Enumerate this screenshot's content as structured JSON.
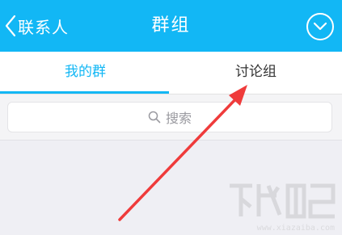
{
  "header": {
    "back_label": "联系人",
    "title": "群组",
    "menu_icon": "chevron-down-circle-icon"
  },
  "tabs": [
    {
      "label": "我的群",
      "active": true
    },
    {
      "label": "讨论组",
      "active": false
    }
  ],
  "search": {
    "placeholder": "搜索",
    "icon": "search-icon"
  },
  "annotation": {
    "color": "#ef3b3b"
  },
  "watermark": {
    "url": "www.xiazaiba.com"
  },
  "colors": {
    "accent": "#12b7f5",
    "background": "#efeff4"
  }
}
